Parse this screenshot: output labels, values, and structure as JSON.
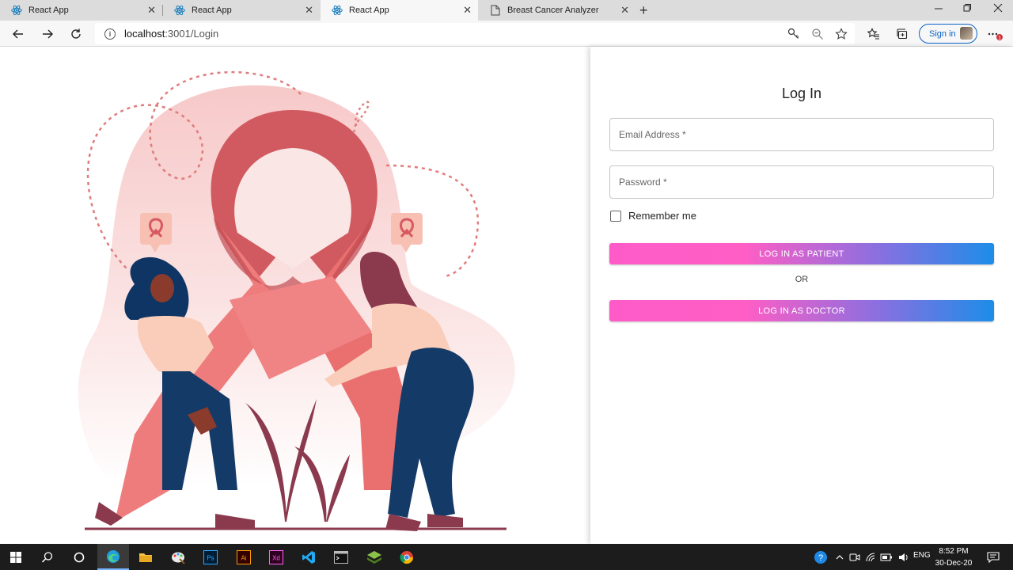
{
  "browser": {
    "tabs": [
      {
        "label": "React App",
        "icon": "react-icon",
        "active": false
      },
      {
        "label": "React App",
        "icon": "react-icon",
        "active": false
      },
      {
        "label": "React App",
        "icon": "react-icon",
        "active": true
      },
      {
        "label": "Breast Cancer Analyzer",
        "icon": "page-icon",
        "active": false
      }
    ],
    "close_glyph": "✕",
    "new_tab_glyph": "+",
    "url_host": "localhost",
    "url_path": ":3001/Login",
    "signin_label": "Sign in",
    "notification_badge": "1"
  },
  "login": {
    "title": "Log In",
    "email_placeholder": "Email Address *",
    "password_placeholder": "Password *",
    "remember_label": "Remember me",
    "patient_button": "LOG IN AS PATIENT",
    "or_text": "OR",
    "doctor_button": "LOG IN AS DOCTOR",
    "button_gradient": [
      "#fe5bc8",
      "#8a6fe0",
      "#1c8de8"
    ]
  },
  "taskbar": {
    "lang": "ENG",
    "time": "8:52 PM",
    "date": "30-Dec-20"
  },
  "colors": {
    "ribbon": "#e97a7a",
    "ribbon_dark": "#cf5a5e",
    "pants": "#143a67",
    "skin": "#f9cdb9",
    "hair_dark": "#0f3564",
    "hair_maroon": "#8b3a4e"
  }
}
